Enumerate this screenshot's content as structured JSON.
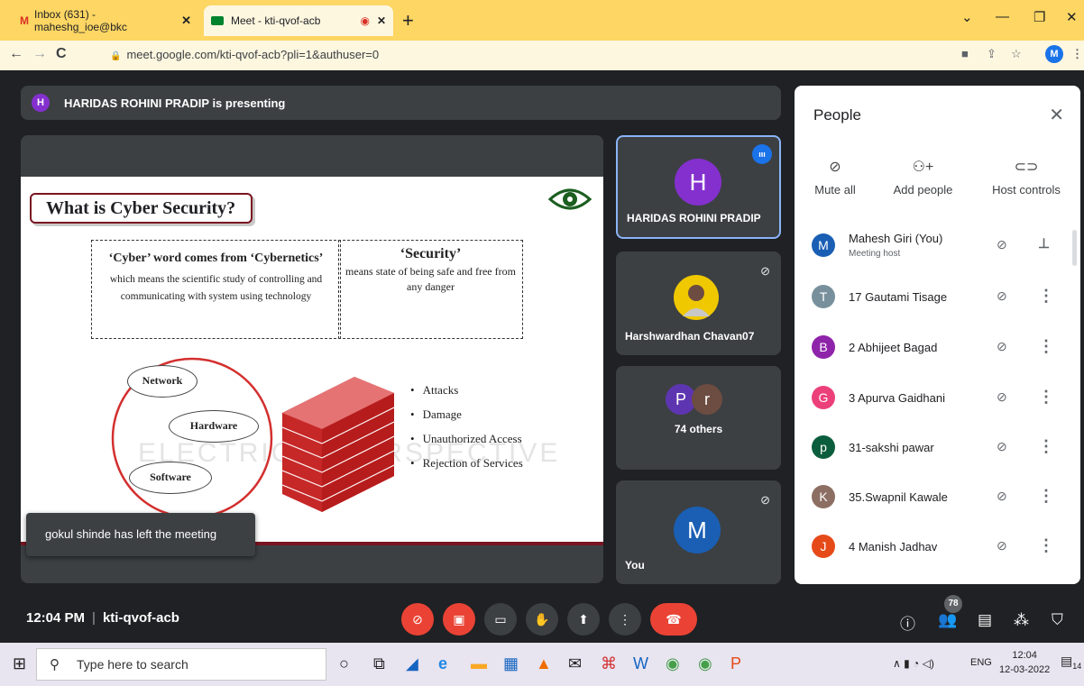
{
  "browser": {
    "tabs": [
      {
        "label": "Inbox (631) - maheshg_ioe@bkc",
        "icon": "gmail-icon"
      },
      {
        "label": "Meet - kti-qvof-acb",
        "icon": "meet-icon"
      }
    ],
    "url": "meet.google.com/kti-qvof-acb?pli=1&authuser=0",
    "profile_initial": "M"
  },
  "presenter": {
    "initial": "H",
    "text": "HARIDAS ROHINI PRADIP is presenting"
  },
  "slide": {
    "title": "What is Cyber Security?",
    "box1_heading": "‘Cyber’ word comes from ‘Cybernetics’",
    "box1_text": "which means the scientific study of controlling and communicating with system using technology",
    "box2_heading": "‘Security’",
    "box2_text": "means state of being safe and free from any danger",
    "clouds": [
      "Network",
      "Hardware",
      "Software"
    ],
    "bullets": [
      "Attacks",
      "Damage",
      "Unauthorized Access",
      "Rejection of Services"
    ],
    "watermark": "ELECTRICAL PERSPECTIVE"
  },
  "toast": "gokul shinde has left the meeting",
  "tiles": [
    {
      "name": "HARIDAS ROHINI PRADIP",
      "initial": "H"
    },
    {
      "name": "Harshwardhan Chavan07"
    },
    {
      "name": "74 others",
      "initials": [
        "P",
        "r"
      ]
    },
    {
      "name": "You",
      "initial": "M"
    }
  ],
  "meeting": {
    "time": "12:04 PM",
    "code": "kti-qvof-acb"
  },
  "people_count": "78",
  "panel": {
    "title": "People",
    "actions": [
      "Mute all",
      "Add people",
      "Host controls"
    ],
    "participants": [
      {
        "initial": "M",
        "name": "Mahesh Giri (You)",
        "sub": "Meeting host",
        "color": "#1a5fb4"
      },
      {
        "initial": "T",
        "name": "17 Gautami Tisage",
        "color": "#78909c"
      },
      {
        "initial": "B",
        "name": "2 Abhijeet Bagad",
        "color": "#8e24aa"
      },
      {
        "initial": "G",
        "name": "3 Apurva Gaidhani",
        "color": "#ec407a"
      },
      {
        "initial": "p",
        "name": "31-sakshi pawar",
        "color": "#0b5e3d"
      },
      {
        "initial": "K",
        "name": "35.Swapnil Kawale",
        "color": "#8d6e63"
      },
      {
        "initial": "J",
        "name": "4 Manish Jadhav",
        "color": "#e64a19"
      }
    ]
  },
  "taskbar": {
    "search_placeholder": "Type here to search",
    "lang": "ENG",
    "time": "12:04",
    "date": "12-03-2022",
    "notifications": "14"
  }
}
